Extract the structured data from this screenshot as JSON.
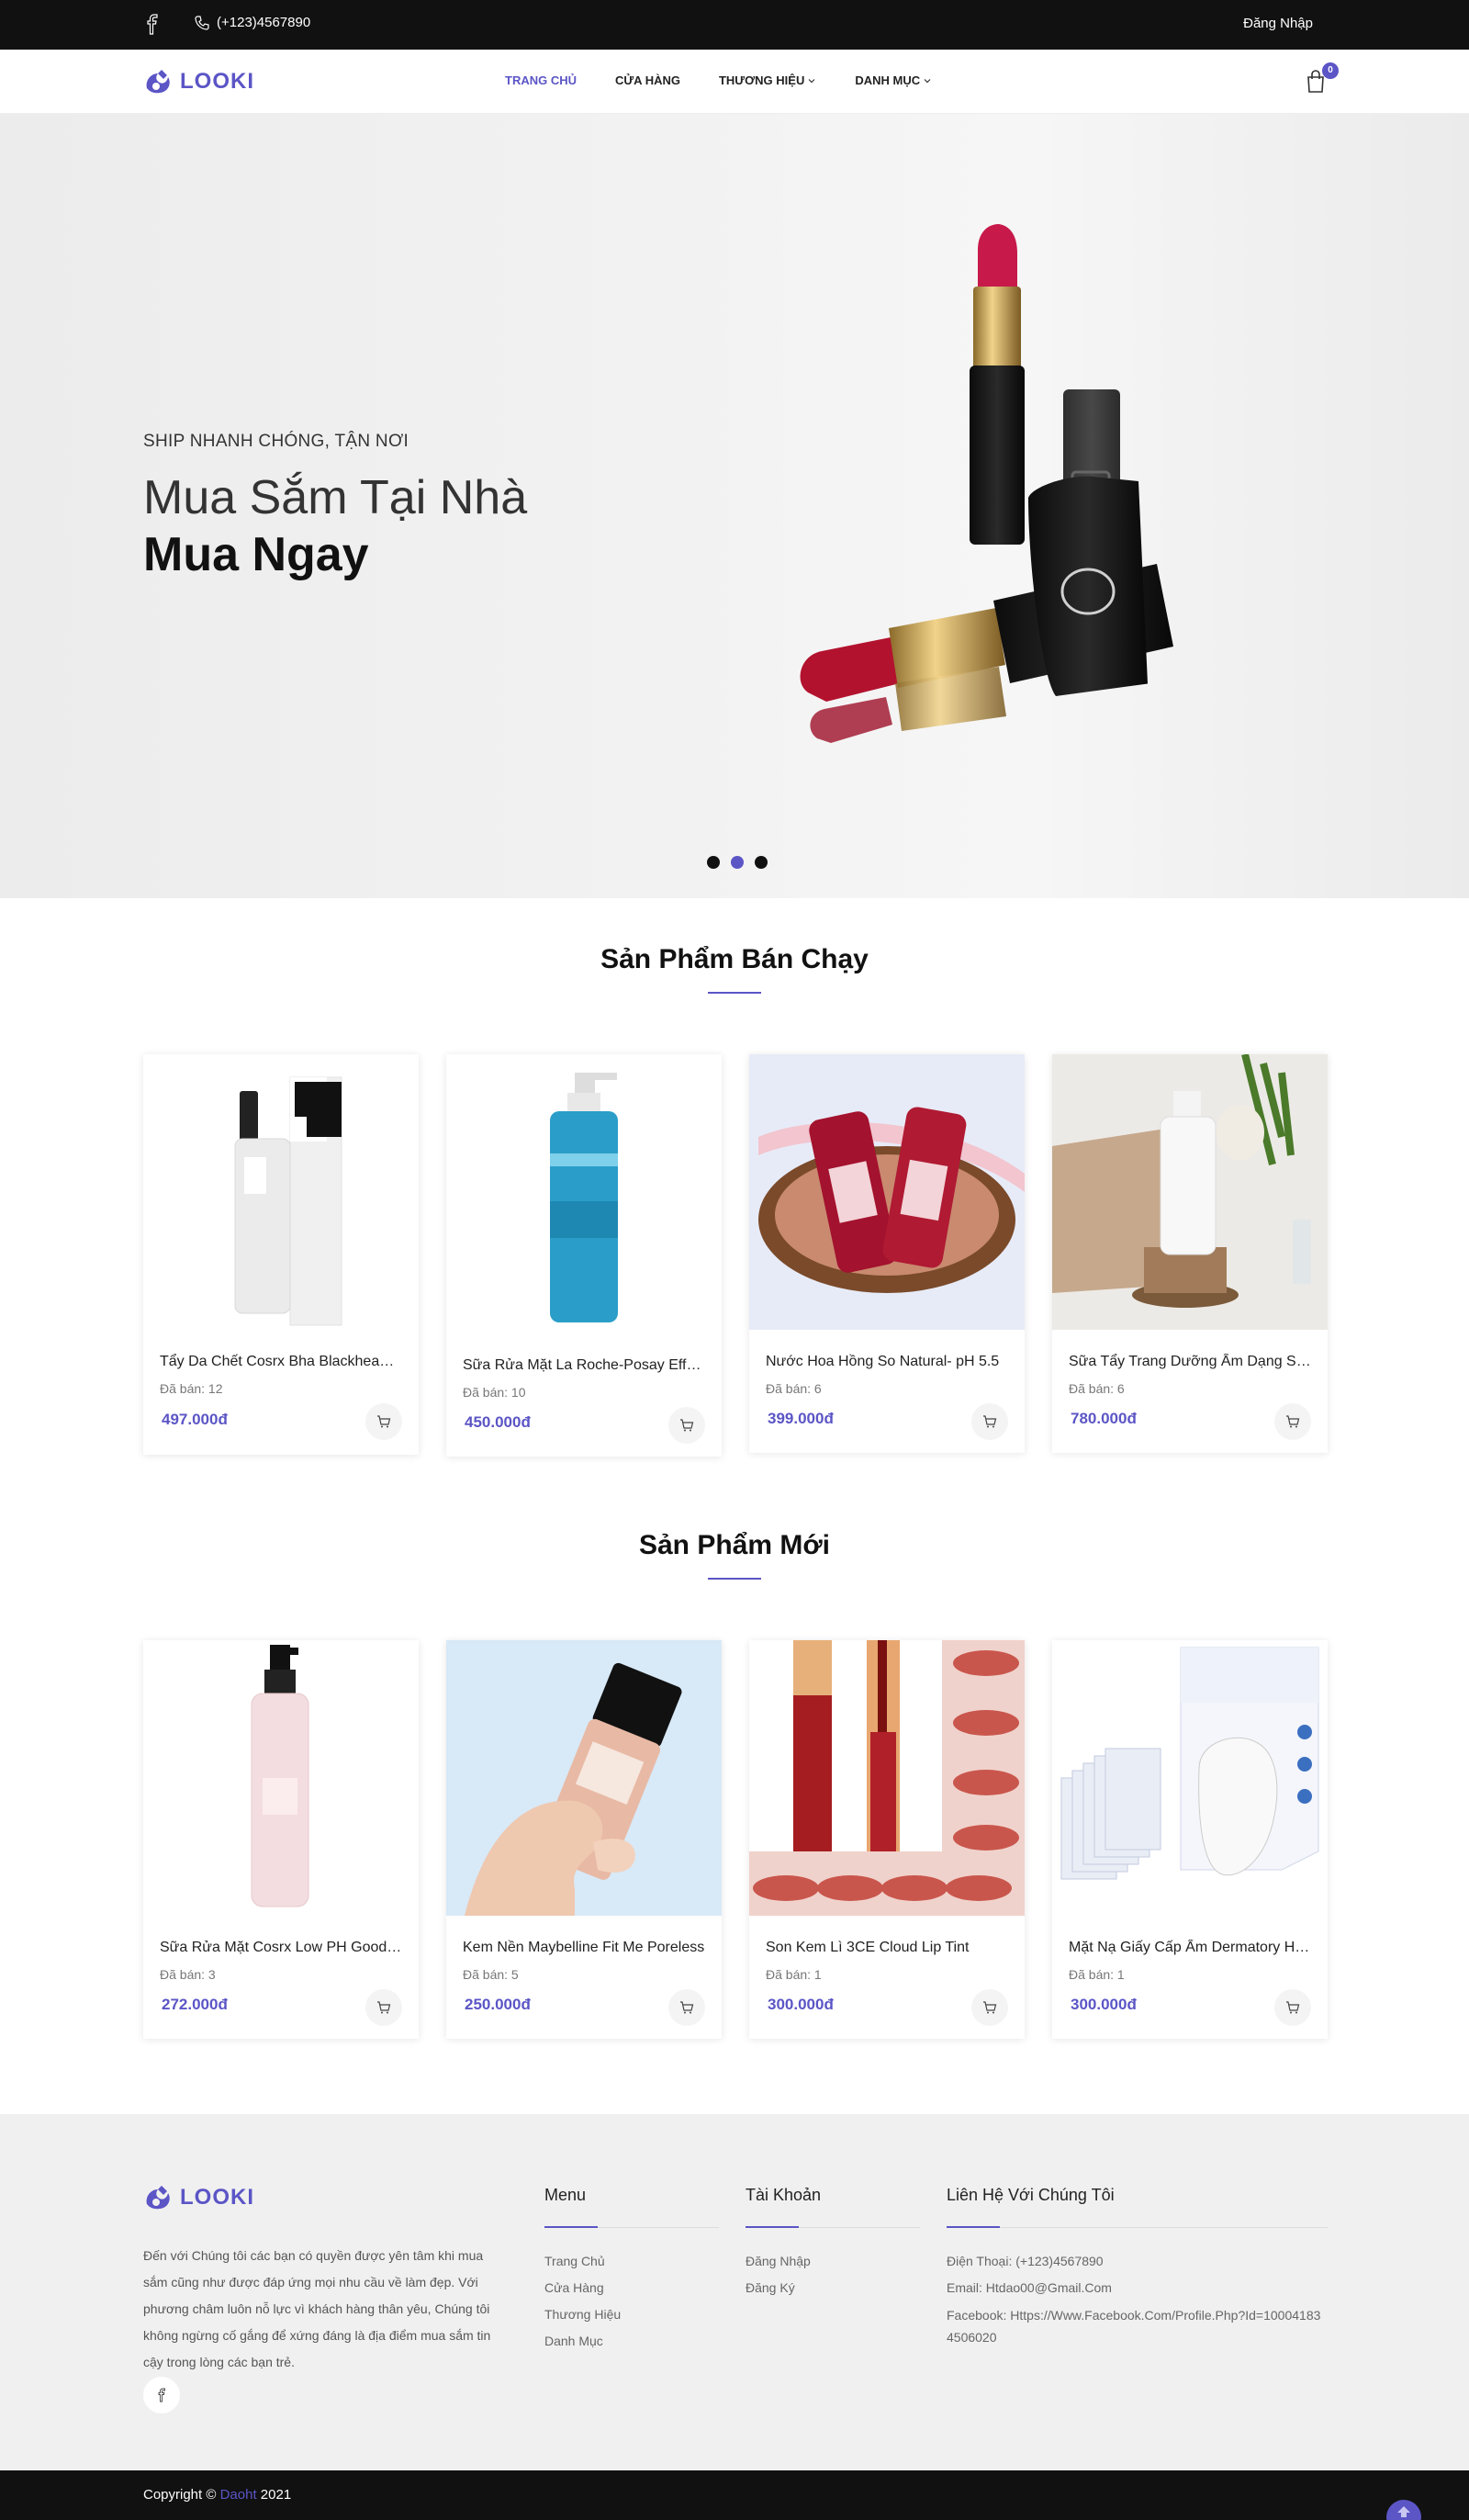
{
  "topbar": {
    "phone": "(+123)4567890",
    "login": "Đăng Nhập"
  },
  "header": {
    "logo": "LOOKI",
    "nav": [
      {
        "label": "TRANG CHỦ",
        "active": true
      },
      {
        "label": "CỬA HÀNG",
        "active": false
      },
      {
        "label": "THƯƠNG HIỆU",
        "active": false
      },
      {
        "label": "DANH MỤC",
        "active": false
      }
    ],
    "cart_count": "0"
  },
  "hero": {
    "subtitle": "SHIP NHANH CHÓNG, TẬN NƠI",
    "line1": "Mua Sắm Tại Nhà",
    "line2": "Mua Ngay",
    "active_slide": 2
  },
  "bestsellers": {
    "title": "Sản Phẩm Bán Chạy",
    "products": [
      {
        "name": "Tẩy Da Chết Cosrx Bha Blackhead Power Liquid",
        "sold": "Đã bán: 12",
        "price": "497.000đ"
      },
      {
        "name": "Sữa Rửa Mặt La Roche-Posay Effaclar",
        "sold": "Đã bán: 10",
        "price": "450.000đ"
      },
      {
        "name": "Nước Hoa Hồng So Natural- pH 5.5",
        "sold": "Đã bán: 6",
        "price": "399.000đ"
      },
      {
        "name": "Sữa Tẩy Trang Dưỡng Ẩm Dạng Sữa",
        "sold": "Đã bán: 6",
        "price": "780.000đ"
      }
    ]
  },
  "newproducts": {
    "title": "Sản Phẩm Mới",
    "products": [
      {
        "name": "Sữa Rửa Mặt Cosrx Low PH Good Morning",
        "sold": "Đã bán: 3",
        "price": "272.000đ"
      },
      {
        "name": "Kem Nền Maybelline Fit Me Poreless",
        "sold": "Đã bán: 5",
        "price": "250.000đ"
      },
      {
        "name": "Son Kem Lì 3CE Cloud Lip Tint",
        "sold": "Đã bán: 1",
        "price": "300.000đ"
      },
      {
        "name": "Mặt Nạ Giấy Cấp Ẩm Dermatory Hyal",
        "sold": "Đã bán: 1",
        "price": "300.000đ"
      }
    ]
  },
  "footer": {
    "logo": "LOOKI",
    "about": "Đến với Chúng tôi các bạn có quyền được yên tâm khi mua sắm cũng như được đáp ứng mọi nhu cầu về làm đẹp. Với phương châm luôn nỗ lực vì khách hàng thân yêu, Chúng tôi không ngừng cố gắng để xứng đáng là địa điểm mua sắm tin cậy trong lòng các bạn trẻ.",
    "menu": {
      "title": "Menu",
      "items": [
        "Trang Chủ",
        "Cửa Hàng",
        "Thương Hiệu",
        "Danh Mục"
      ]
    },
    "account": {
      "title": "Tài Khoản",
      "items": [
        "Đăng Nhập",
        "Đăng Ký"
      ]
    },
    "contact": {
      "title": "Liên Hệ Với Chúng Tôi",
      "phone": "Điện Thoại: (+123)4567890",
      "email": "Email: Htdao00@Gmail.Com",
      "facebook": "Facebook: Https://Www.Facebook.Com/Profile.Php?Id=100041834506020"
    }
  },
  "copyright": {
    "prefix": "Copyright © ",
    "brand": "Daoht",
    "year": " 2021"
  },
  "colors": {
    "accent": "#5b55c6",
    "topbar": "#111111",
    "footer_bg": "#f0f0f0"
  }
}
